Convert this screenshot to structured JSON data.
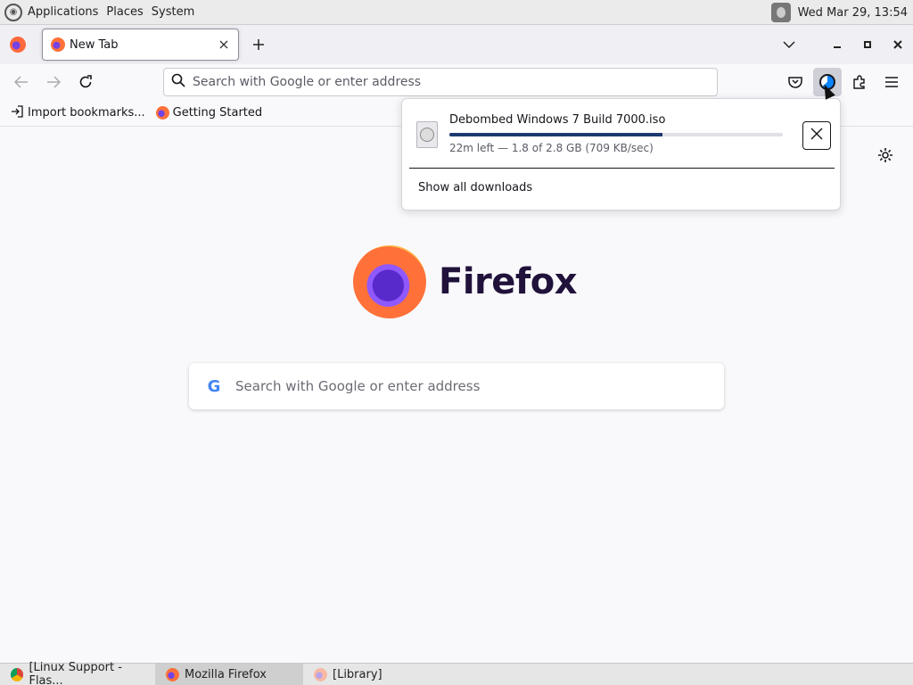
{
  "top_panel": {
    "menus": [
      "Applications",
      "Places",
      "System"
    ],
    "clock": "Wed Mar 29, 13:54"
  },
  "tabs": [
    {
      "title": "New Tab"
    }
  ],
  "navbar": {
    "url_placeholder": "Search with Google or enter address"
  },
  "bookmarks": [
    {
      "label": "Import bookmarks..."
    },
    {
      "label": "Getting Started"
    }
  ],
  "newtab": {
    "wordmark": "Firefox",
    "search_placeholder": "Search with Google or enter address"
  },
  "downloads_panel": {
    "file_name": "Debombed Windows 7 Build 7000.iso",
    "progress_fraction": 0.64,
    "status": "22m left — 1.8 of 2.8 GB (709 KB/sec)",
    "show_all": "Show all downloads"
  },
  "taskbar": [
    {
      "label": "[Linux Support - Flas...",
      "active": false,
      "icon": "chrome-icon"
    },
    {
      "label": "Mozilla Firefox",
      "active": true,
      "icon": "firefox-icon"
    },
    {
      "label": "[Library]",
      "active": false,
      "icon": "firefox-icon"
    }
  ],
  "colors": {
    "progress": "#1c3a6e",
    "firefox_purple": "#20123a"
  }
}
